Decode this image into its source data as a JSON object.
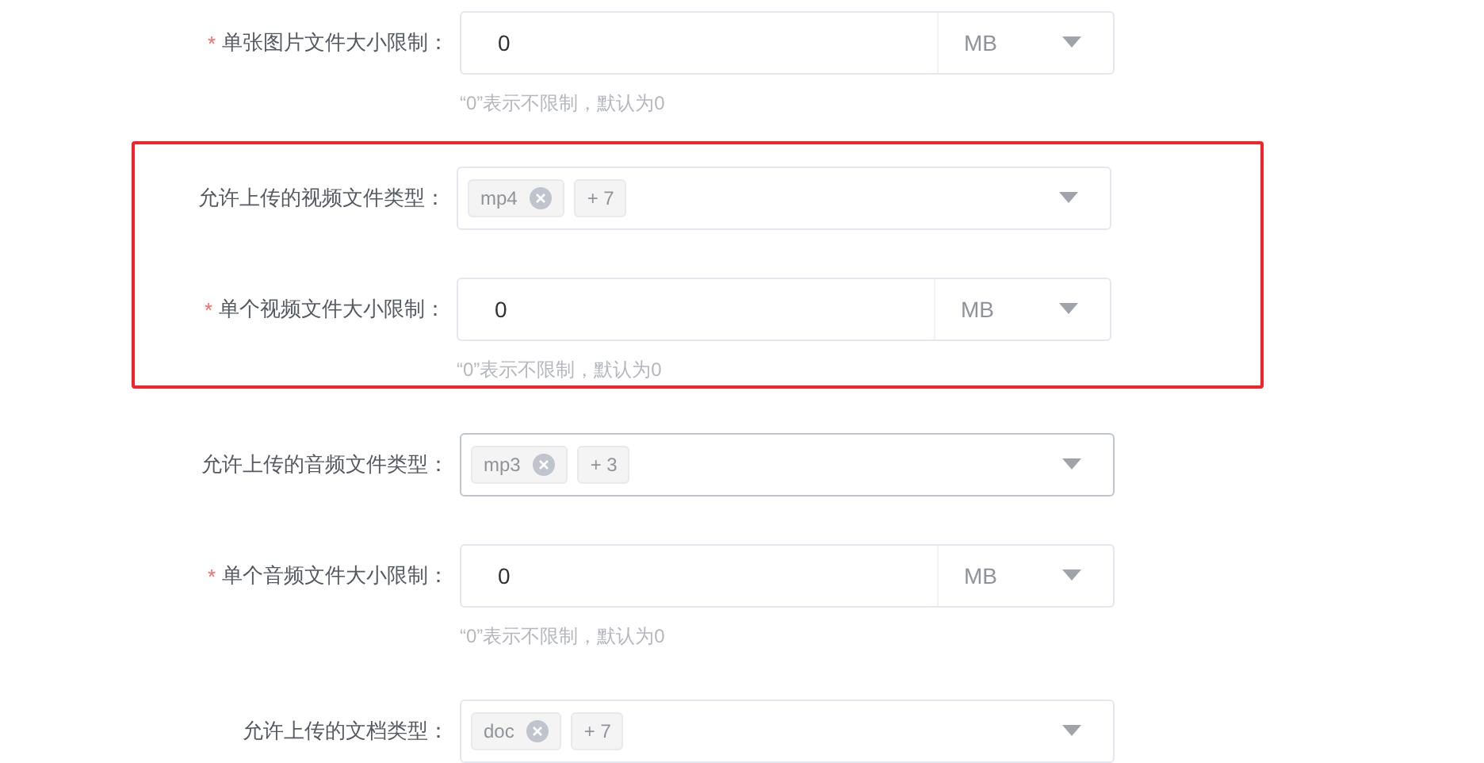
{
  "form": {
    "fields": [
      {
        "kind": "size",
        "label": "单张图片文件大小限制：",
        "required_mark": "*",
        "value": "0",
        "unit": "MB",
        "hint": "“0”表示不限制，默认为0",
        "highlighted": false
      },
      {
        "kind": "types",
        "label": "允许上传的视频文件类型：",
        "tags": [
          "mp4"
        ],
        "more": "+ 7",
        "hovered": false,
        "highlighted": true
      },
      {
        "kind": "size",
        "label": "单个视频文件大小限制：",
        "required_mark": "*",
        "value": "0",
        "unit": "MB",
        "hint": "“0”表示不限制，默认为0",
        "highlighted": true
      },
      {
        "kind": "types",
        "label": "允许上传的音频文件类型：",
        "tags": [
          "mp3"
        ],
        "more": "+ 3",
        "hovered": true,
        "highlighted": false
      },
      {
        "kind": "size",
        "label": "单个音频文件大小限制：",
        "required_mark": "*",
        "value": "0",
        "unit": "MB",
        "hint": "“0”表示不限制，默认为0",
        "highlighted": false
      },
      {
        "kind": "types",
        "label": "允许上传的文档类型：",
        "tags": [
          "doc"
        ],
        "more": "+ 7",
        "hovered": false,
        "highlighted": false
      }
    ]
  }
}
